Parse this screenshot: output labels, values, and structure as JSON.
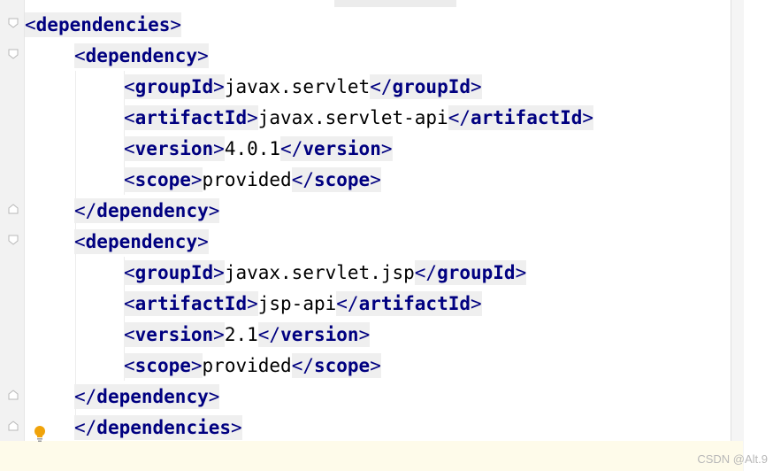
{
  "editor": {
    "lines": [
      {
        "indent": 0,
        "open": "<",
        "name": "dependencies",
        "close": ">",
        "text": "",
        "end_open": "",
        "end_name": "",
        "end_close": ""
      },
      {
        "indent": 1,
        "open": "<",
        "name": "dependency",
        "close": ">",
        "text": "",
        "end_open": "",
        "end_name": "",
        "end_close": ""
      },
      {
        "indent": 2,
        "open": "<",
        "name": "groupId",
        "close": ">",
        "text": "javax.servlet",
        "end_open": "</",
        "end_name": "groupId",
        "end_close": ">"
      },
      {
        "indent": 2,
        "open": "<",
        "name": "artifactId",
        "close": ">",
        "text": "javax.servlet-api",
        "end_open": "</",
        "end_name": "artifactId",
        "end_close": ">"
      },
      {
        "indent": 2,
        "open": "<",
        "name": "version",
        "close": ">",
        "text": "4.0.1",
        "end_open": "</",
        "end_name": "version",
        "end_close": ">"
      },
      {
        "indent": 2,
        "open": "<",
        "name": "scope",
        "close": ">",
        "text": "provided",
        "end_open": "</",
        "end_name": "scope",
        "end_close": ">"
      },
      {
        "indent": 1,
        "open": "</",
        "name": "dependency",
        "close": ">",
        "text": "",
        "end_open": "",
        "end_name": "",
        "end_close": ""
      },
      {
        "indent": 1,
        "open": "<",
        "name": "dependency",
        "close": ">",
        "text": "",
        "end_open": "",
        "end_name": "",
        "end_close": ""
      },
      {
        "indent": 2,
        "open": "<",
        "name": "groupId",
        "close": ">",
        "text": "javax.servlet.jsp",
        "end_open": "</",
        "end_name": "groupId",
        "end_close": ">"
      },
      {
        "indent": 2,
        "open": "<",
        "name": "artifactId",
        "close": ">",
        "text": "jsp-api",
        "end_open": "</",
        "end_name": "artifactId",
        "end_close": ">"
      },
      {
        "indent": 2,
        "open": "<",
        "name": "version",
        "close": ">",
        "text": "2.1",
        "end_open": "</",
        "end_name": "version",
        "end_close": ">"
      },
      {
        "indent": 2,
        "open": "<",
        "name": "scope",
        "close": ">",
        "text": "provided",
        "end_open": "</",
        "end_name": "scope",
        "end_close": ">"
      },
      {
        "indent": 1,
        "open": "</",
        "name": "dependency",
        "close": ">",
        "text": "",
        "end_open": "",
        "end_name": "",
        "end_close": ""
      },
      {
        "indent": 1,
        "open": "</",
        "name": "dependencies",
        "close": ">",
        "text": "",
        "end_open": "",
        "end_name": "",
        "end_close": ""
      }
    ]
  },
  "gutter": {
    "fold_icons": [
      "fold-open",
      "fold-open",
      "fold-close",
      "fold-open",
      "fold-close",
      "fold-close"
    ],
    "intention_icon": "lightbulb-icon",
    "intention_color": "#f0a30a"
  },
  "colors": {
    "tag_name": "#000080",
    "tag_bg": "#efefef",
    "current_line": "#fefbea"
  },
  "watermark": {
    "text": "CSDN @Alt.9"
  }
}
